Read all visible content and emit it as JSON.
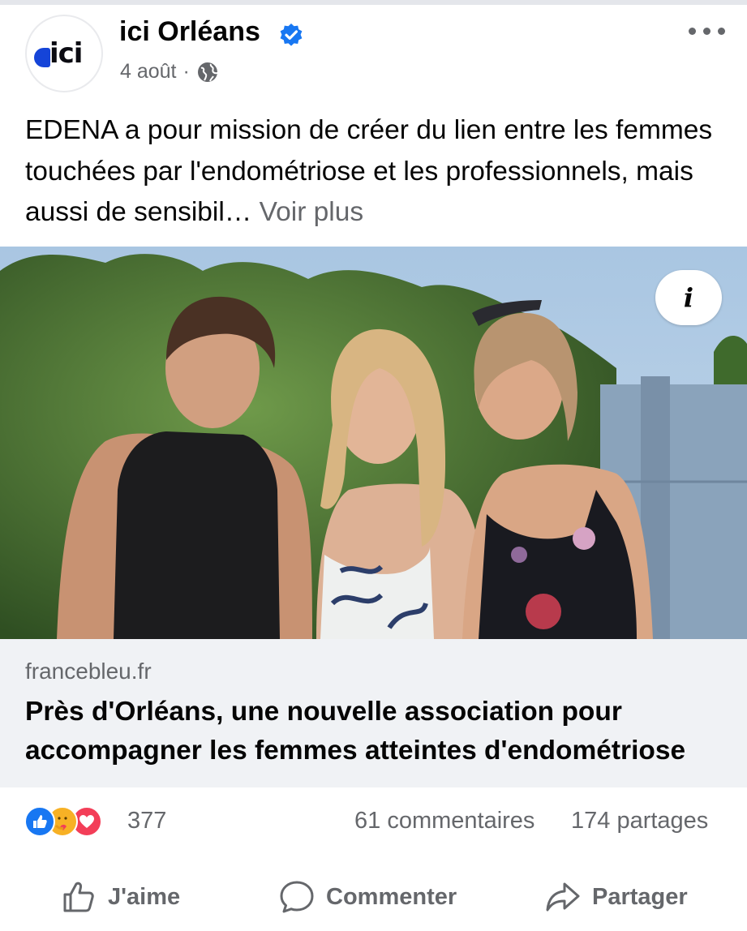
{
  "post": {
    "page_name": "ici Orléans",
    "avatar_logo": "ici",
    "date": "4 août",
    "separator": "·",
    "verified_icon": "verified-badge-icon",
    "privacy_icon": "globe-icon",
    "text": "EDENA a pour mission de créer du lien entre les femmes touchées par l'endométriose et les professionnels, mais aussi de sensibil…",
    "see_more": "Voir plus"
  },
  "photo": {
    "info_label": "i"
  },
  "link_preview": {
    "domain": "francebleu.fr",
    "title": "Près d'Orléans, une nouvelle association pour accompagner les femmes atteintes d'endométriose"
  },
  "stats": {
    "reaction_icons": [
      "like-icon",
      "care-icon",
      "love-icon"
    ],
    "reactions_count": "377",
    "comments": "61 commentaires",
    "shares": "174 partages"
  },
  "actions": {
    "like": "J'aime",
    "comment": "Commenter",
    "share": "Partager"
  },
  "colors": {
    "facebook_blue": "#1877f2",
    "love_red": "#f33e58",
    "care_yellow": "#f7b125",
    "secondary_text": "#65676b",
    "link_bg": "#f0f2f5"
  }
}
